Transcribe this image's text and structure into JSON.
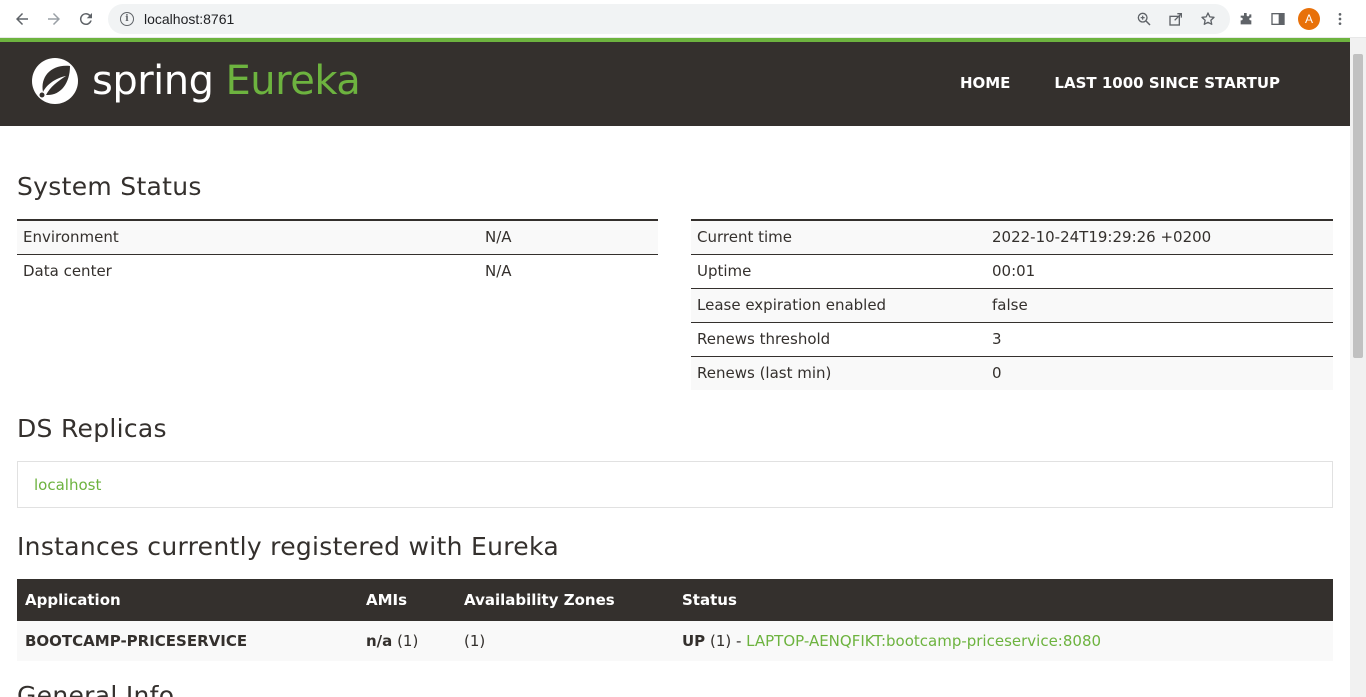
{
  "browser": {
    "url": "localhost:8761",
    "avatar_letter": "A"
  },
  "header": {
    "logo_spring": "spring",
    "logo_eureka": "Eureka",
    "nav": [
      "HOME",
      "LAST 1000 SINCE STARTUP"
    ]
  },
  "system_status": {
    "title": "System Status",
    "left": [
      {
        "key": "Environment",
        "value": "N/A"
      },
      {
        "key": "Data center",
        "value": "N/A"
      }
    ],
    "right": [
      {
        "key": "Current time",
        "value": "2022-10-24T19:29:26 +0200"
      },
      {
        "key": "Uptime",
        "value": "00:01"
      },
      {
        "key": "Lease expiration enabled",
        "value": "false"
      },
      {
        "key": "Renews threshold",
        "value": "3"
      },
      {
        "key": "Renews (last min)",
        "value": "0"
      }
    ]
  },
  "ds_replicas": {
    "title": "DS Replicas",
    "link": "localhost"
  },
  "instances": {
    "title": "Instances currently registered with Eureka",
    "columns": [
      "Application",
      "AMIs",
      "Availability Zones",
      "Status"
    ],
    "rows": [
      {
        "application": "BOOTCAMP-PRICESERVICE",
        "amis_label": "n/a",
        "amis_count": "(1)",
        "zones": "(1)",
        "status_label": "UP",
        "status_count": "(1) - ",
        "status_link": "LAPTOP-AENQFIKT:bootcamp-priceservice:8080"
      }
    ]
  },
  "general_info": {
    "title": "General Info"
  },
  "colors": {
    "brand_dark": "#34302d",
    "brand_green": "#6db33f"
  }
}
